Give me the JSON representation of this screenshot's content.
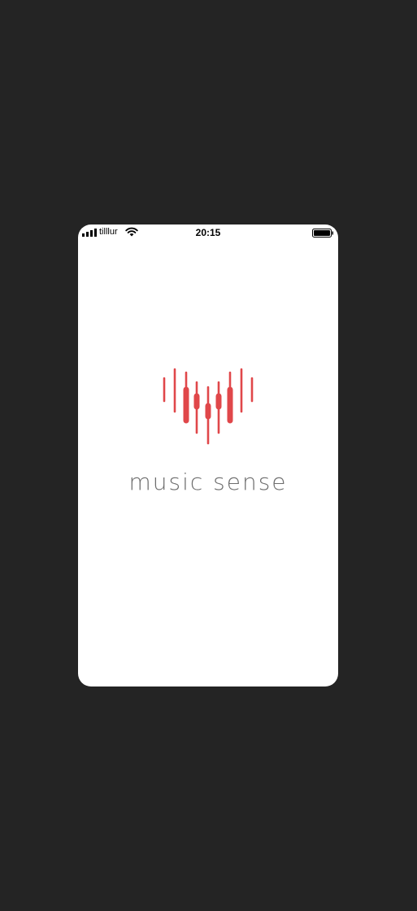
{
  "status_bar": {
    "carrier": "tilllur",
    "time": "20:15"
  },
  "splash": {
    "app_name": "music sense",
    "logo_icon": "heart-equalizer-icon"
  },
  "colors": {
    "background": "#242424",
    "screen": "#ffffff",
    "brand_red": "#e0474a",
    "wordmark": "#6d6d6d"
  }
}
